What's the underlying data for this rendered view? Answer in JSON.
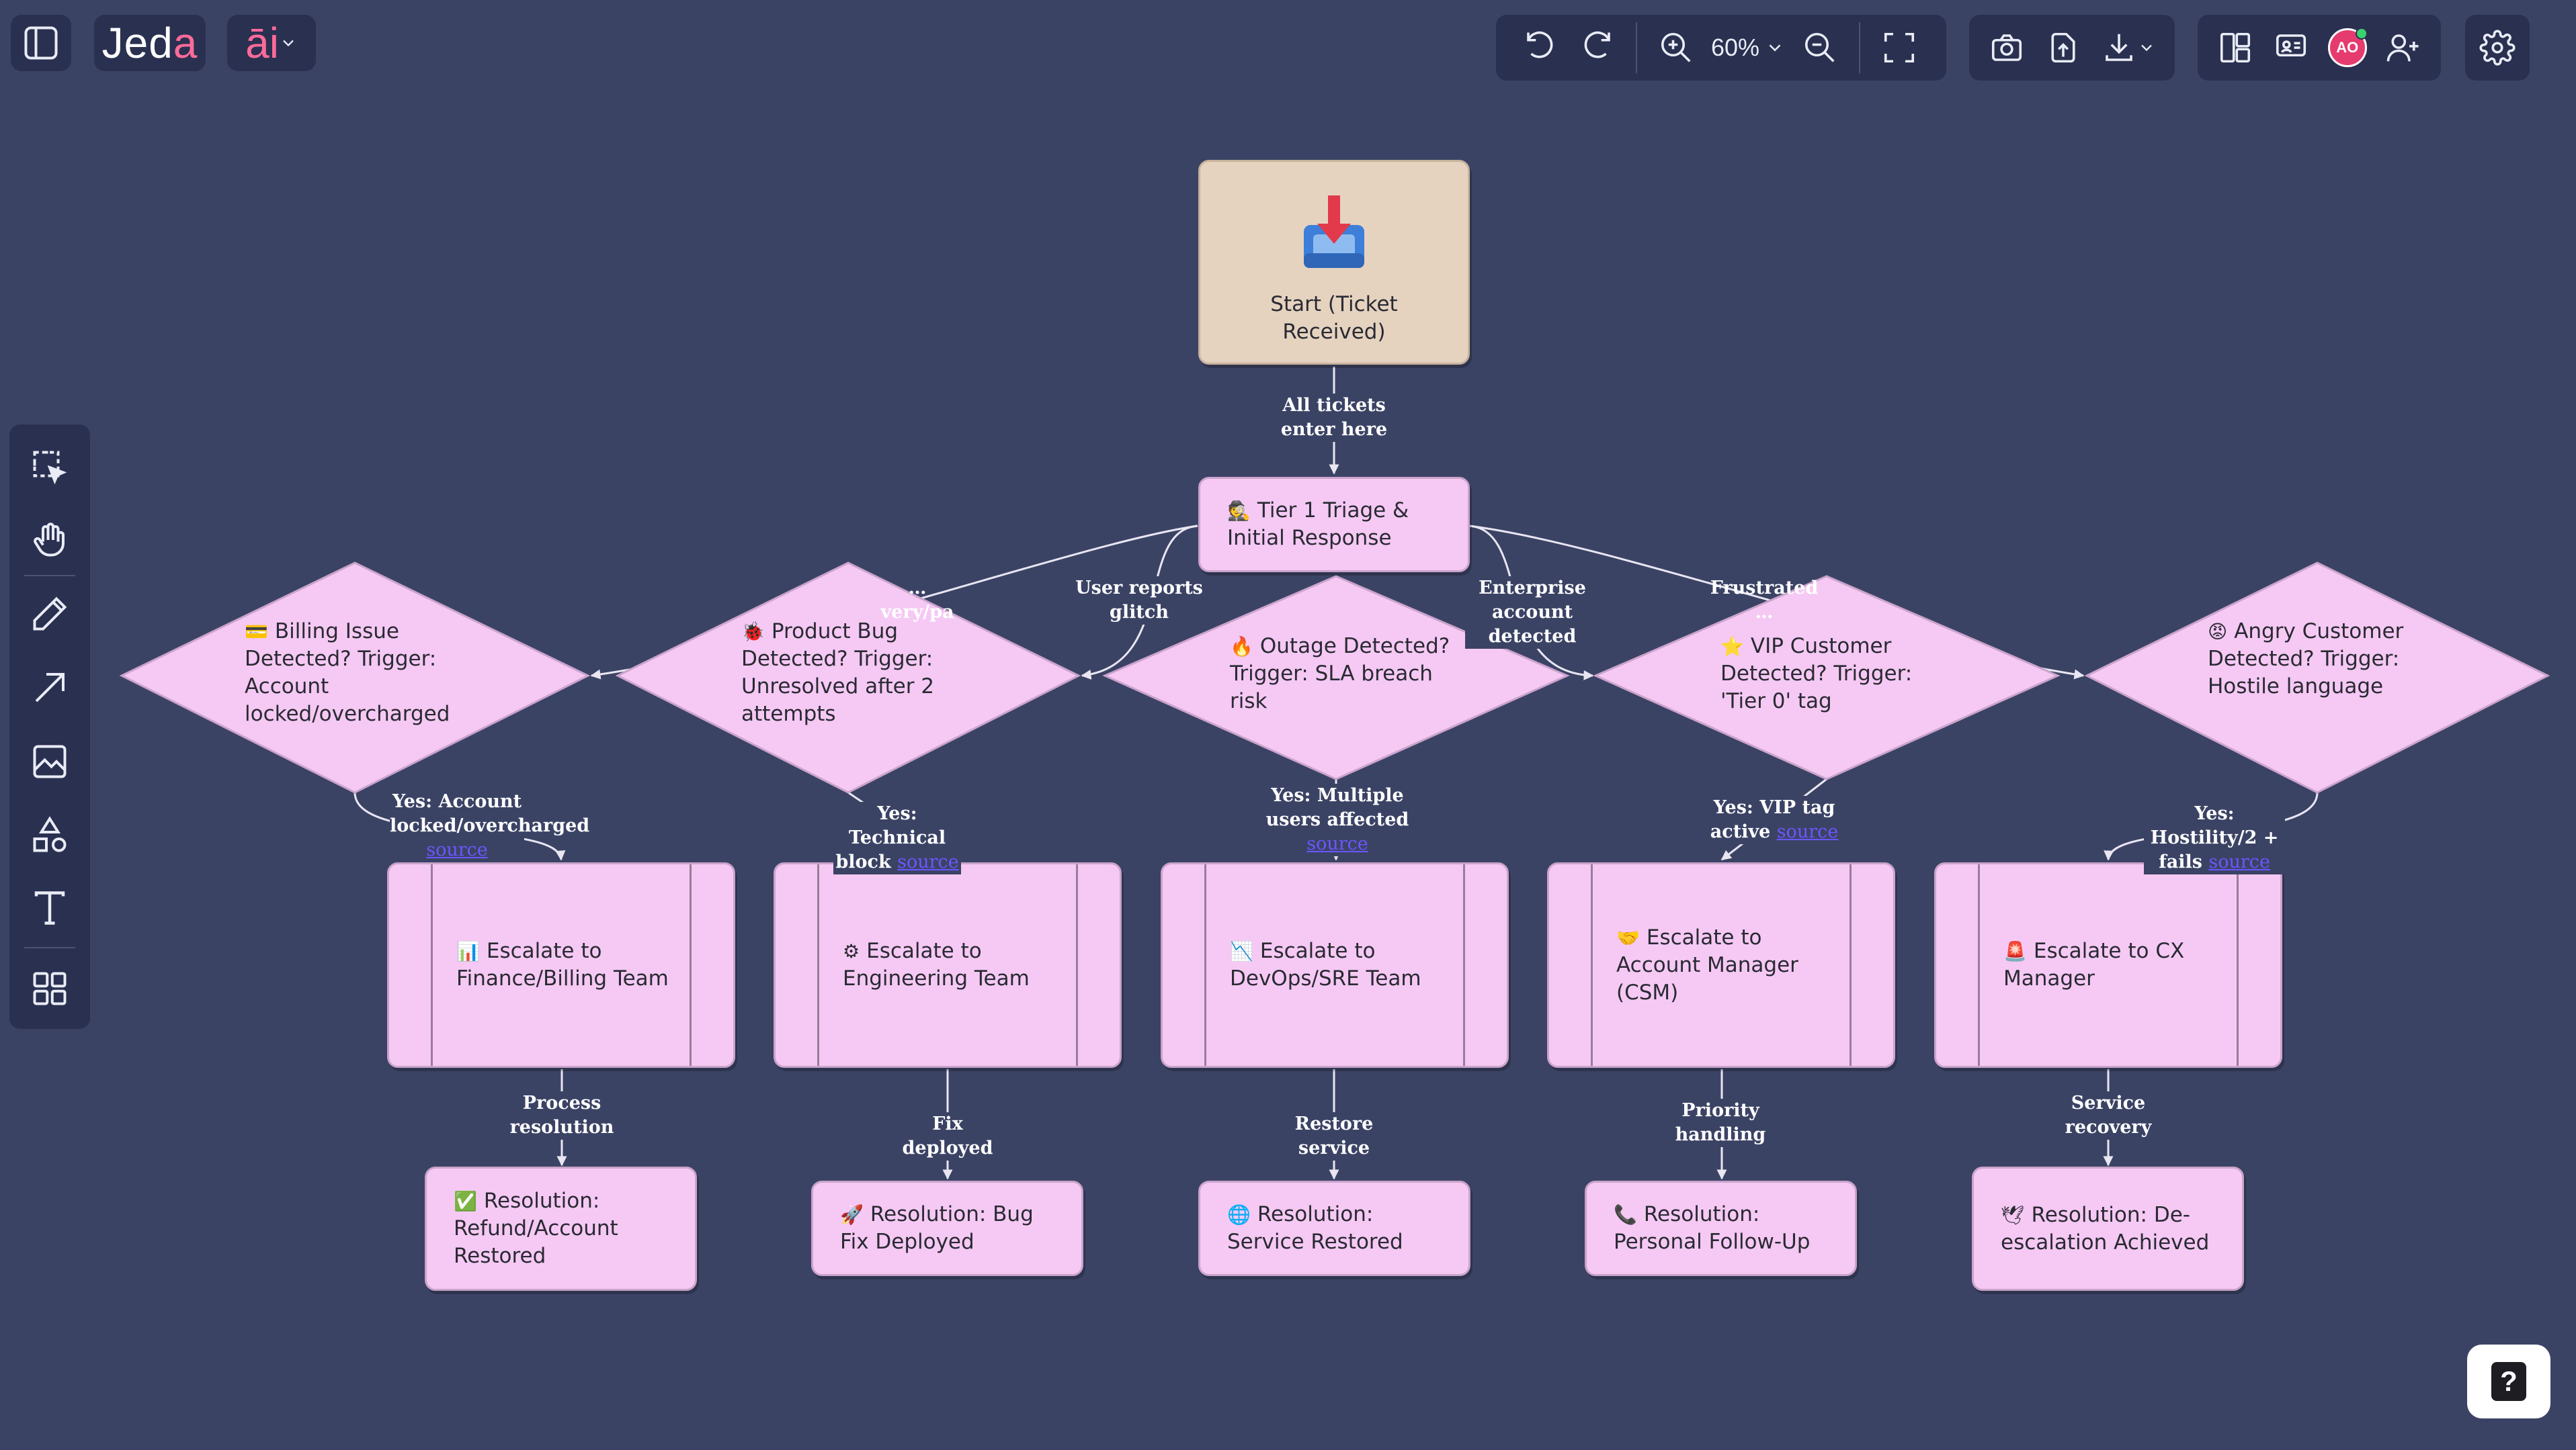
{
  "app": {
    "logo": "Jed",
    "logo_accent": "a",
    "ai_label": "āi"
  },
  "toolbar": {
    "zoom": "60%"
  },
  "user": {
    "initials": "AO"
  },
  "colors": {
    "background": "#3b4365",
    "panel": "#2a3050",
    "node": "#f5c9f4",
    "start_node": "#e5d3c0",
    "brand_accent": "#ff6b9a"
  },
  "icons": {
    "top": [
      "sidebar-toggle-icon",
      "undo-icon",
      "redo-icon",
      "zoom-in-icon",
      "chevron-down-icon",
      "zoom-out-icon",
      "fit-screen-icon",
      "camera-icon",
      "upload-icon",
      "download-icon",
      "layout-icon",
      "present-icon",
      "add-user-icon",
      "gear-icon"
    ],
    "left": [
      "select-icon",
      "hand-icon",
      "pen-icon",
      "arrow-icon",
      "image-icon",
      "shapes-icon",
      "text-icon",
      "components-icon"
    ]
  },
  "flow": {
    "start": {
      "label": "Start (Ticket Received)"
    },
    "triage": {
      "emoji": "🕵",
      "label": "Tier 1 Triage & Initial Response"
    },
    "decisions": [
      {
        "emoji": "💳",
        "label": "Billing Issue Detected? Trigger: Account locked/overcharged"
      },
      {
        "emoji": "🐞",
        "label": "Product Bug Detected? Trigger: Unresolved after 2 attempts"
      },
      {
        "emoji": "🔥",
        "label": "Outage Detected? Trigger: SLA breach risk"
      },
      {
        "emoji": "⭐",
        "label": "VIP Customer Detected? Trigger: 'Tier 0' tag"
      },
      {
        "emoji": "😡",
        "label": "Angry Customer Detected? Trigger: Hostile language"
      }
    ],
    "escalations": [
      {
        "emoji": "📊",
        "label": "Escalate to Finance/Billing Team"
      },
      {
        "emoji": "⚙",
        "label": "Escalate to Engineering Team"
      },
      {
        "emoji": "📉",
        "label": "Escalate to DevOps/SRE Team"
      },
      {
        "emoji": "🤝",
        "label": "Escalate to Account Manager (CSM)"
      },
      {
        "emoji": "🚨",
        "label": "Escalate to CX Manager"
      }
    ],
    "resolutions": [
      {
        "emoji": "✅",
        "label": "Resolution: Refund/Account Restored"
      },
      {
        "emoji": "🚀",
        "label": "Resolution: Bug Fix Deployed"
      },
      {
        "emoji": "🌐",
        "label": "Resolution: Service Restored"
      },
      {
        "emoji": "📞",
        "label": "Resolution: Personal Follow-Up"
      },
      {
        "emoji": "🕊",
        "label": "Resolution: De-escalation Achieved"
      }
    ],
    "edge_labels": {
      "start_to_triage": "All tickets enter here",
      "to_billing": "…very/pa",
      "to_bug": "User reports glitch",
      "to_vip": "Enterprise account detected",
      "to_angry": "Frustrated …",
      "yes_billing": "Yes: Account locked/overcharged",
      "yes_bug": "Yes: Technical block",
      "yes_outage": "Yes: Multiple users affected",
      "yes_vip": "Yes: VIP tag active",
      "yes_angry": "Yes: Hostility/2 + fails",
      "source": "source",
      "res_billing": "Process resolution",
      "res_bug": "Fix deployed",
      "res_outage": "Restore service",
      "res_vip": "Priority handling",
      "res_angry": "Service recovery"
    }
  }
}
